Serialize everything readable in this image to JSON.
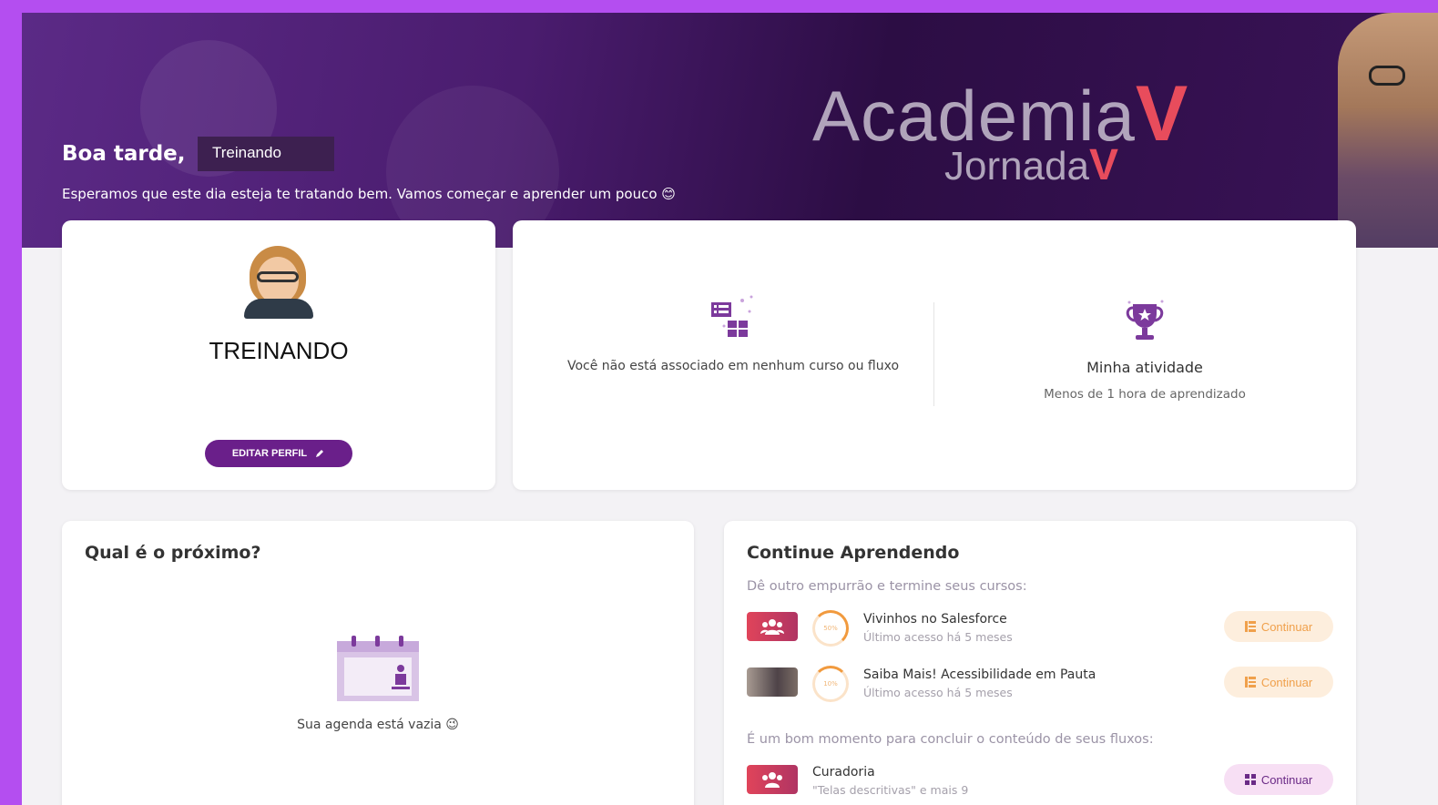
{
  "banner": {
    "greeting": "Boa tarde,",
    "user_name": "Treinando",
    "welcome": "Esperamos que este dia esteja te tratando bem. Vamos começar e aprender um pouco 😊",
    "brand_title": "Academia",
    "brand_subtitle": "Jornada"
  },
  "profile": {
    "name": "TREINANDO",
    "edit_label": "EDITAR PERFIL"
  },
  "stats": {
    "courses_text": "Você não está associado em nenhum curso ou fluxo",
    "activity_title": "Minha atividade",
    "activity_sub": "Menos de 1 hora de aprendizado"
  },
  "next": {
    "title": "Qual é o próximo?",
    "empty_text": "Sua agenda está vazia 😉"
  },
  "continue": {
    "title": "Continue Aprendendo",
    "courses_sub": "Dê outro empurrão e termine seus cursos:",
    "courses": [
      {
        "name": "Vivinhos no Salesforce",
        "meta": "Último acesso há 5 meses",
        "progress": "50%",
        "button": "Continuar"
      },
      {
        "name": "Saiba Mais! Acessibilidade em Pauta",
        "meta": "Último acesso há 5 meses",
        "progress": "10%",
        "button": "Continuar"
      }
    ],
    "flows_sub": "É um bom momento para concluir o conteúdo de seus fluxos:",
    "flows": [
      {
        "name": "Curadoria",
        "meta": "\"Telas descritivas\" e mais 9",
        "button": "Continuar"
      }
    ]
  },
  "colors": {
    "accent_purple": "#6a1f8a",
    "continue_orange": "#f0a04b",
    "brand_red": "#e84c5c"
  }
}
